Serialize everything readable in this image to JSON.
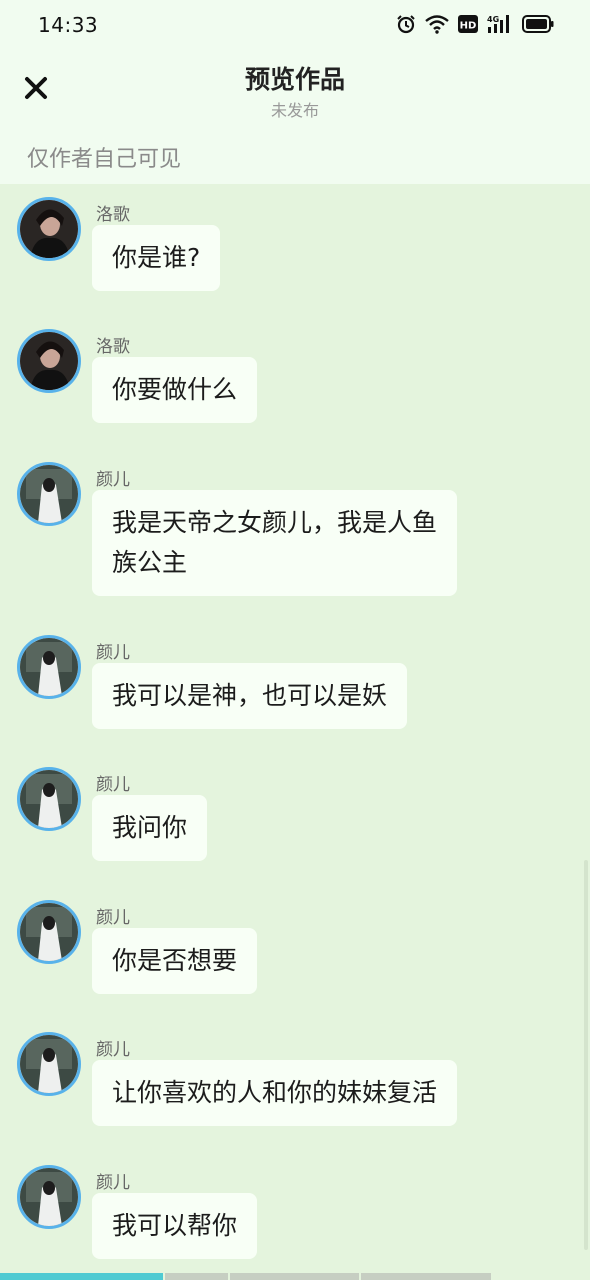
{
  "status_bar": {
    "time": "14:33",
    "network_label": "4G",
    "hd_label": "HD"
  },
  "header": {
    "title": "预览作品",
    "subtitle": "未发布",
    "visibility_note": "仅作者自己可见"
  },
  "messages": [
    {
      "sender": "洛歌",
      "text": "你是谁?"
    },
    {
      "sender": "洛歌",
      "text": "你要做什么"
    },
    {
      "sender": "颜儿",
      "text_lines": [
        "我是天帝之女颜儿，我是人鱼",
        "族公主"
      ]
    },
    {
      "sender": "颜儿",
      "text": "我可以是神，也可以是妖"
    },
    {
      "sender": "颜儿",
      "text": "我问你"
    },
    {
      "sender": "颜儿",
      "text": "你是否想要"
    },
    {
      "sender": "颜儿",
      "text": "让你喜欢的人和你的妹妹复活"
    },
    {
      "sender": "颜儿",
      "text": "我可以帮你"
    }
  ],
  "colors": {
    "background": "#e4f4dd",
    "header_bg": "#f1fcf0",
    "bubble": "#f8fff6",
    "avatar_ring": "#58b2ea",
    "progress": "#4fcad2"
  }
}
